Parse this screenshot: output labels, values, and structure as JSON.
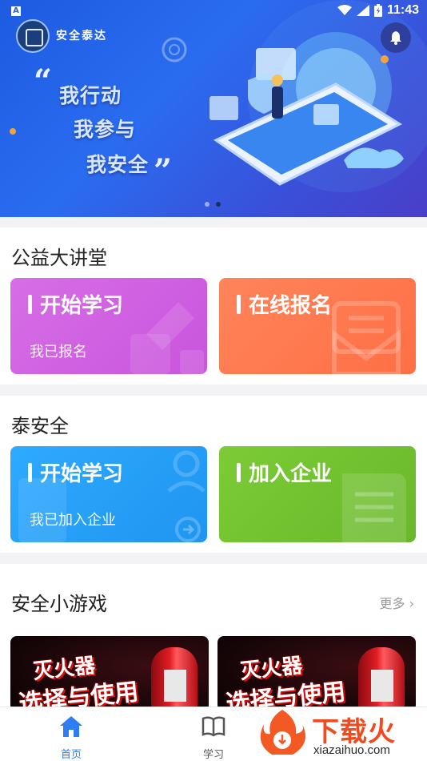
{
  "status_bar": {
    "badge": "A",
    "time": "11:43"
  },
  "banner": {
    "brand": "安全泰达",
    "slogan": [
      "我行动",
      "我参与",
      "我安全"
    ],
    "page_dots": 2,
    "active_dot": 1
  },
  "lecture": {
    "title": "公益大讲堂",
    "cards": [
      {
        "title": "开始学习",
        "subtitle": "我已报名",
        "color": "#d65fe0"
      },
      {
        "title": "在线报名",
        "subtitle": "",
        "color": "#ff7a4d"
      }
    ]
  },
  "safety": {
    "title": "泰安全",
    "cards": [
      {
        "title": "开始学习",
        "subtitle": "我已加入企业",
        "color": "#2aa2f6"
      },
      {
        "title": "加入企业",
        "subtitle": "",
        "color": "#72bf2f"
      }
    ]
  },
  "games": {
    "title": "安全小游戏",
    "more": "更多",
    "items": [
      {
        "line1": "灭火器",
        "line2": "选择与使用"
      },
      {
        "line1": "灭火器",
        "line2": "选择与使用"
      }
    ]
  },
  "tabbar": {
    "tabs": [
      {
        "label": "首页",
        "active": true
      },
      {
        "label": "学习",
        "active": false
      }
    ],
    "active_color": "#2f7df3"
  },
  "watermark": {
    "text": "下载火",
    "url": "xiazaihuo.com"
  }
}
